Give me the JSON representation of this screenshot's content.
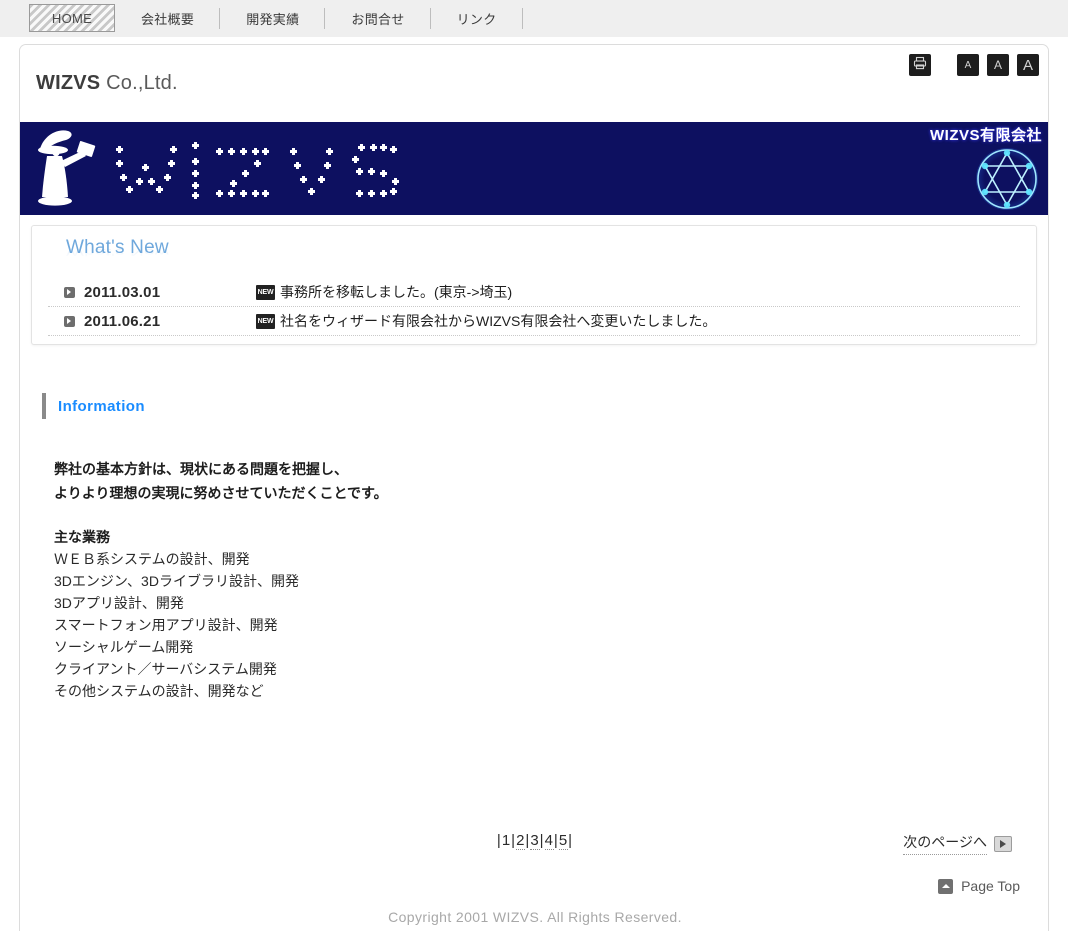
{
  "nav": {
    "items": [
      {
        "label": "HOME",
        "active": true
      },
      {
        "label": "会社概要",
        "active": false
      },
      {
        "label": "開発実績",
        "active": false
      },
      {
        "label": "お問合せ",
        "active": false
      },
      {
        "label": "リンク",
        "active": false
      }
    ]
  },
  "header": {
    "brand_bold": "WIZVS",
    "brand_rest": " Co.,Ltd.",
    "tools": [
      {
        "name": "print-button",
        "icon": "printer-icon",
        "label": ""
      },
      {
        "name": "font-size-small-button",
        "icon": "letter-a-icon",
        "label": "A"
      },
      {
        "name": "font-size-medium-button",
        "icon": "letter-a-icon",
        "label": "A"
      },
      {
        "name": "font-size-large-button",
        "icon": "letter-a-icon",
        "label": "A"
      }
    ]
  },
  "banner": {
    "logo_text": "WIZVS",
    "corp_name": "WIZVS有限会社",
    "background_color": "#0d1060",
    "accent_color": "#28e0ff"
  },
  "whats_new": {
    "title": "What's New",
    "title_color": "#6fa8dc",
    "rows": [
      {
        "date": "2011.03.01",
        "badge": "NEW",
        "text": "事務所を移転しました。(東京->埼玉)"
      },
      {
        "date": "2011.06.21",
        "badge": "NEW",
        "text": "社名をウィザード有限会社からWIZVS有限会社へ変更いたしました。"
      }
    ]
  },
  "information": {
    "title": "Information",
    "title_color": "#1a8cff",
    "lead_line1": "弊社の基本方針は、現状にある問題を把握し、",
    "lead_line2": "よりより理想の実現に努めさせていただくことです。",
    "services_heading": "主な業務",
    "services": [
      "ＷＥＢ系システムの設計、開発",
      "3Dエンジン、3Dライブラリ設計、開発",
      "3Dアプリ設計、開発",
      "スマートフォン用アプリ設計、開発",
      "ソーシャルゲーム開発",
      "クライアント／サーバシステム開発",
      "その他システムの設計、開発など"
    ]
  },
  "pagination": {
    "pages": [
      "1",
      "2",
      "3",
      "4",
      "5"
    ],
    "current": "1",
    "separator": "|",
    "next_label": "次のページへ"
  },
  "footer": {
    "page_top_label": "Page Top",
    "copyright": "Copyright 2001 WIZVS. All Rights Reserved."
  }
}
